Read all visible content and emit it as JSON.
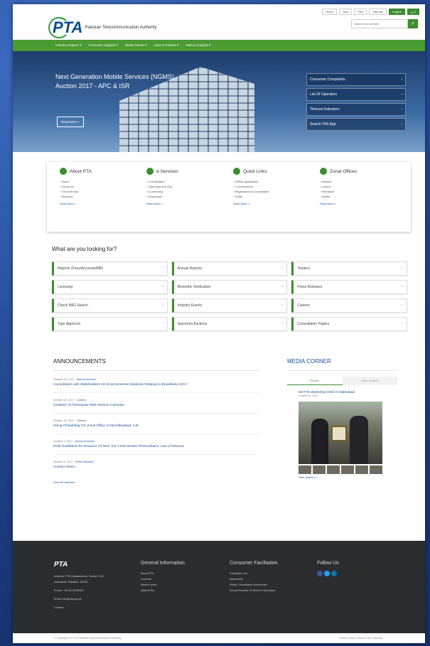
{
  "top_links": [
    "Home",
    "Jobs",
    "FAQ",
    "Sitemap",
    "English",
    "اردو"
  ],
  "logo": {
    "mark": "PTA",
    "org": "Pakistan Telecommunication Authority"
  },
  "search": {
    "placeholder": "Search this website"
  },
  "nav": [
    "Industry Support ▾",
    "Consumer Support ▾",
    "Media Center ▾",
    "Laws & Policies ▾",
    "Data & Analysis ▾"
  ],
  "hero": {
    "title": "Next Generation Mobile Services (NGMS) Auction 2017 - APC & ISR",
    "read_more": "Read More »"
  },
  "quick_buttons": [
    "Consumer Complaints",
    "List Of Operators",
    "Telecom Indicators",
    "Search TAS App"
  ],
  "cards": [
    {
      "title": "About PTA",
      "items": [
        "Vision",
        "Functions",
        "The Authority",
        "Divisions"
      ],
      "more": "Read More »"
    },
    {
      "title": "e-Services",
      "items": [
        "e-Verification",
        "Type Approval (TA)",
        "e-Licensing",
        "Downloads"
      ],
      "more": "Read More »"
    },
    {
      "title": "Quick Links",
      "items": [
        "DIRBS Application",
        "e-Government",
        "Registration of Consultants",
        "Tariffs"
      ],
      "more": "Read More »"
    },
    {
      "title": "Zonal Offices",
      "items": [
        "Karachi",
        "Lahore",
        "Peshawar",
        "Quetta"
      ],
      "more": "Read More »"
    }
  ],
  "looking_title": "What are you looking for?",
  "looking_items": [
    "Reports (Fees/Accounts/MB)",
    "Annual Reports",
    "Tenders",
    "Licensing",
    "Biometric Verification",
    "Press Releases",
    "Check IMEI Search",
    "Industry Events",
    "Careers",
    "Type Approval",
    "Spectrum Auctions",
    "Consultation Papers"
  ],
  "announcements": {
    "title": "ANNOUNCEMENTS",
    "items": [
      {
        "date": "October 20, 2017",
        "cat": "Announcements",
        "text": "Consultation with Stakeholders On Environmental Initiatives Relating to Broadband 2017"
      },
      {
        "date": "October 19, 2017",
        "cat": "Careers",
        "text": "Invitation To Participate DWI Session Calendar"
      },
      {
        "date": "October 18, 2017",
        "cat": "Careers",
        "text": "Hiring Of Building For Zonal Office At Muzaffarabad, AJK"
      },
      {
        "date": "October 9, 2017",
        "cat": "Announcements",
        "text": "Draft Guidelines for Issuance Of NOC For Cross Border Photovoltaics, Law of Telecom"
      },
      {
        "date": "October 6, 2017",
        "cat": "Press Releases",
        "text": "Auction Notice"
      }
    ],
    "view_all": "View All Updates"
  },
  "media": {
    "title": "MEDIA CORNER",
    "tabs": [
      "Photos",
      "Video Gallery"
    ],
    "item_title": "MATTE Workshop Held At Islamabad",
    "item_date": "August 24, 2017",
    "view_gallery": "View Gallery »»"
  },
  "footer": {
    "logo": "PTA",
    "address": "Address: PTA Headquarters, Sector F-5/1 Islamabad, Pakistan, 44000",
    "phone": "Phone: +92-51-9225325",
    "email": "Email: info@pta.gov.pk",
    "contact": "Contact",
    "general_title": "General Information",
    "general_items": [
      "About PTA",
      "Licensee",
      "Media Center",
      "Awards Etc"
    ],
    "consumer_title": "Consumer Facilitation",
    "consumer_items": [
      "Complaint, Info",
      "Awareness",
      "Public Consultation Documents",
      "Annual Reports Of Telecom Operators"
    ],
    "follow_title": "Follow Us",
    "copyright": "© Copyright 2017 PTA Pakistan Telecommunication Authority",
    "bottom_right": "Privacy Policy | Terms of Use | Sitemap"
  },
  "colors": {
    "green": "#3c8d2f",
    "blue": "#1a4f8f",
    "bg": "#2b57a8"
  }
}
